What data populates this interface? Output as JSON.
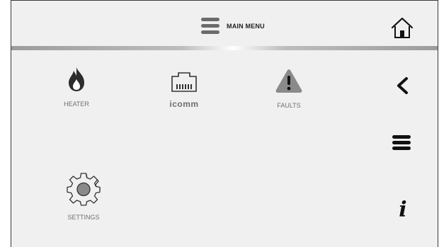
{
  "header": {
    "title": "MAIN MENU",
    "menu_icon": "hamburger-icon",
    "home_icon": "home-icon"
  },
  "tiles": [
    {
      "label": "HEATER",
      "icon": "flame-icon"
    },
    {
      "label": "icomm",
      "icon": "connector-icon"
    },
    {
      "label": "FAULTS",
      "icon": "warning-icon"
    },
    {
      "label": "SETTINGS",
      "icon": "gear-icon"
    }
  ],
  "sidebar": {
    "back_icon": "chevron-left-icon",
    "menu_icon": "hamburger-icon",
    "info_text": "i",
    "info_icon": "info-icon"
  },
  "colors": {
    "background": "#f0f0f0",
    "icon_gray": "#6b6b6b",
    "icon_dark": "#111111",
    "label_gray": "#707070"
  }
}
